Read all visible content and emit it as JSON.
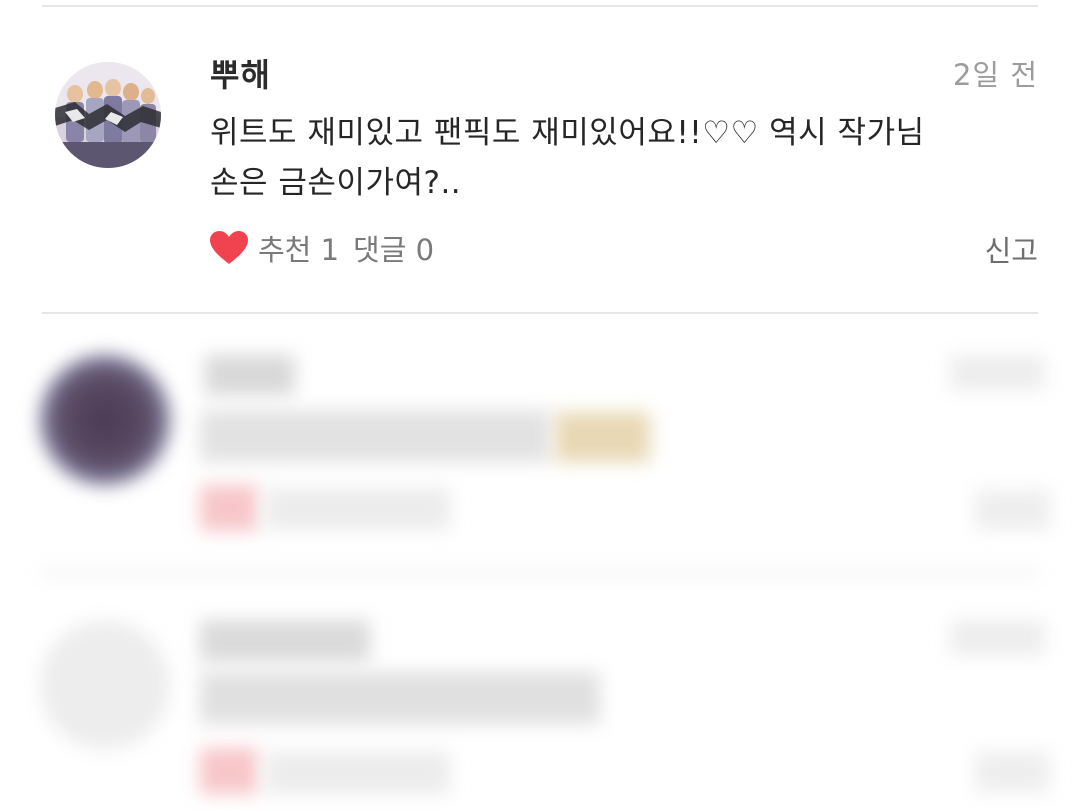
{
  "comment": {
    "author": "뿌해",
    "time": "2일 전",
    "text_line1": "위트도 재미있고 팬픽도 재미있어요!!♡♡ 역시 작가님",
    "text_line2": "손은 금손이가여?..",
    "like_label": "추천 1",
    "reply_label": "댓글 0",
    "report_label": "신고",
    "like_color": "#f0424f"
  }
}
